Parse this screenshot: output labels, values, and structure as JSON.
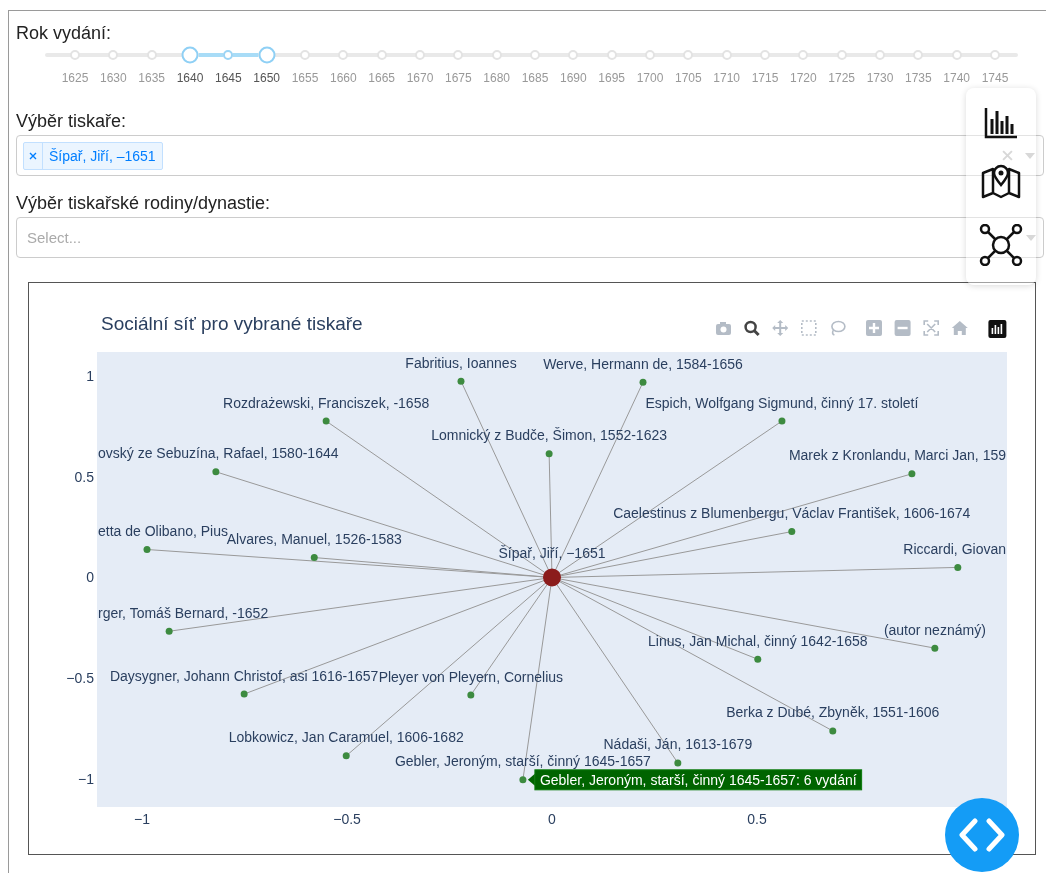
{
  "year_slider": {
    "label": "Rok vydání:",
    "marks": [
      {
        "label": "1625",
        "selected": false
      },
      {
        "label": "1630",
        "selected": false
      },
      {
        "label": "1635",
        "selected": false
      },
      {
        "label": "1640",
        "selected": true
      },
      {
        "label": "1645",
        "selected": true
      },
      {
        "label": "1650",
        "selected": true
      },
      {
        "label": "1655",
        "selected": false
      },
      {
        "label": "1660",
        "selected": false
      },
      {
        "label": "1665",
        "selected": false
      },
      {
        "label": "1670",
        "selected": false
      },
      {
        "label": "1675",
        "selected": false
      },
      {
        "label": "1680",
        "selected": false
      },
      {
        "label": "1685",
        "selected": false
      },
      {
        "label": "1690",
        "selected": false
      },
      {
        "label": "1695",
        "selected": false
      },
      {
        "label": "1700",
        "selected": false
      },
      {
        "label": "1705",
        "selected": false
      },
      {
        "label": "1710",
        "selected": false
      },
      {
        "label": "1715",
        "selected": false
      },
      {
        "label": "1720",
        "selected": false
      },
      {
        "label": "1725",
        "selected": false
      },
      {
        "label": "1730",
        "selected": false
      },
      {
        "label": "1735",
        "selected": false
      },
      {
        "label": "1740",
        "selected": false
      },
      {
        "label": "1745",
        "selected": false
      }
    ]
  },
  "printer_select": {
    "label": "Výběr tiskaře:",
    "chips": [
      {
        "text": "Šípař, Jiří, –1651"
      }
    ]
  },
  "family_select": {
    "label": "Výběr tiskařské rodiny/dynastie:",
    "placeholder": "Select..."
  },
  "graph": {
    "modebar": [
      {
        "kind": "camera",
        "selected": false
      },
      {
        "kind": "zoom",
        "selected": true
      },
      {
        "kind": "pan",
        "selected": false
      },
      {
        "kind": "select",
        "selected": false
      },
      {
        "kind": "lasso",
        "selected": false
      },
      {
        "kind": "zoom-in",
        "selected": false
      },
      {
        "kind": "zoom-out",
        "selected": false
      },
      {
        "kind": "autoscale",
        "selected": false
      },
      {
        "kind": "home",
        "selected": false
      },
      {
        "kind": "logo"
      }
    ],
    "chart_data": {
      "type": "scatter",
      "title": "Sociální síť pro vybrané tiskaře",
      "xlim": [
        -1.11,
        1.11
      ],
      "ylim": [
        -1.14,
        1.12
      ],
      "xticks": [
        {
          "value": -1,
          "label": "−1"
        },
        {
          "value": -0.5,
          "label": "−0.5"
        },
        {
          "value": 0,
          "label": "0"
        },
        {
          "value": 0.5,
          "label": "0.5"
        }
      ],
      "yticks": [
        {
          "value": 1,
          "label": "1"
        },
        {
          "value": 0.5,
          "label": "0.5"
        },
        {
          "value": 0,
          "label": "0"
        },
        {
          "value": -0.5,
          "label": "−0.5"
        },
        {
          "value": -1,
          "label": "−1"
        }
      ],
      "x": [
        0,
        -0.222,
        0.222,
        -0.551,
        0.561,
        -0.007,
        -0.82,
        0.878,
        0.585,
        -0.988,
        -0.58,
        0.99,
        -0.934,
        0.934,
        0.502,
        -0.751,
        -0.198,
        0.685,
        -0.502,
        0.307,
        -0.071
      ],
      "series": [
        {
          "name": "Šípař, Jiří, −1651",
          "color": "#8b1c1c",
          "values": [
            0,
            null,
            null,
            null,
            null,
            null,
            null,
            null,
            null,
            null,
            null,
            null,
            null,
            null,
            null,
            null,
            null,
            null,
            null,
            null,
            null
          ]
        },
        {
          "name": "Fabritius, Ioannes",
          "color": "#3d8b40",
          "values": [
            null,
            0.975,
            null,
            null,
            null,
            null,
            null,
            null,
            null,
            null,
            null,
            null,
            null,
            null,
            null,
            null,
            null,
            null,
            null,
            null,
            null
          ]
        },
        {
          "name": "Werve, Hermann de, 1584-1656",
          "color": "#3d8b40",
          "values": [
            null,
            null,
            0.97,
            null,
            null,
            null,
            null,
            null,
            null,
            null,
            null,
            null,
            null,
            null,
            null,
            null,
            null,
            null,
            null,
            null,
            null
          ]
        },
        {
          "name": "Rozdrażewski, Franciszek, -1658",
          "color": "#3d8b40",
          "values": [
            null,
            null,
            null,
            0.777,
            null,
            null,
            null,
            null,
            null,
            null,
            null,
            null,
            null,
            null,
            null,
            null,
            null,
            null,
            null,
            null,
            null
          ]
        },
        {
          "name": "Espich, Wolfgang Sigmund, činný 17. století",
          "color": "#3d8b40",
          "values": [
            null,
            null,
            null,
            null,
            0.777,
            null,
            null,
            null,
            null,
            null,
            null,
            null,
            null,
            null,
            null,
            null,
            null,
            null,
            null,
            null,
            null
          ]
        },
        {
          "name": "Lomnický z Budče, Šimon, 1552-1623",
          "color": "#3d8b40",
          "values": [
            null,
            null,
            null,
            null,
            null,
            0.614,
            null,
            null,
            null,
            null,
            null,
            null,
            null,
            null,
            null,
            null,
            null,
            null,
            null,
            null,
            null
          ]
        },
        {
          "name": "ovský ze Sebuzína, Rafael, 1580-1644",
          "color": "#3d8b40",
          "values": [
            null,
            null,
            null,
            null,
            null,
            null,
            0.525,
            null,
            null,
            null,
            null,
            null,
            null,
            null,
            null,
            null,
            null,
            null,
            null,
            null,
            null
          ]
        },
        {
          "name": "Marek z Kronlandu, Marci Jan, 159",
          "color": "#3d8b40",
          "values": [
            null,
            null,
            null,
            null,
            null,
            null,
            null,
            0.515,
            null,
            null,
            null,
            null,
            null,
            null,
            null,
            null,
            null,
            null,
            null,
            null,
            null
          ]
        },
        {
          "name": "Caelestinus z Blumenbergu, Václav František, 1606-1674",
          "color": "#3d8b40",
          "values": [
            null,
            null,
            null,
            null,
            null,
            null,
            null,
            null,
            0.228,
            null,
            null,
            null,
            null,
            null,
            null,
            null,
            null,
            null,
            null,
            null,
            null
          ]
        },
        {
          "name": "etta de Olibano, Pius",
          "color": "#3d8b40",
          "values": [
            null,
            null,
            null,
            null,
            null,
            null,
            null,
            null,
            null,
            0.139,
            null,
            null,
            null,
            null,
            null,
            null,
            null,
            null,
            null,
            null,
            null
          ]
        },
        {
          "name": "Alvares, Manuel, 1526-1583",
          "color": "#3d8b40",
          "values": [
            null,
            null,
            null,
            null,
            null,
            null,
            null,
            null,
            null,
            null,
            0.099,
            null,
            null,
            null,
            null,
            null,
            null,
            null,
            null,
            null,
            null
          ]
        },
        {
          "name": "Riccardi, Giovan",
          "color": "#3d8b40",
          "values": [
            null,
            null,
            null,
            null,
            null,
            null,
            null,
            null,
            null,
            null,
            null,
            0.05,
            null,
            null,
            null,
            null,
            null,
            null,
            null,
            null,
            null
          ]
        },
        {
          "name": "rger, Tomáš Bernard, -1652",
          "color": "#3d8b40",
          "values": [
            null,
            null,
            null,
            null,
            null,
            null,
            null,
            null,
            null,
            null,
            null,
            null,
            -0.267,
            null,
            null,
            null,
            null,
            null,
            null,
            null,
            null
          ]
        },
        {
          "name": "(autor neznámý)",
          "color": "#3d8b40",
          "values": [
            null,
            null,
            null,
            null,
            null,
            null,
            null,
            null,
            null,
            null,
            null,
            null,
            null,
            -0.351,
            null,
            null,
            null,
            null,
            null,
            null,
            null
          ]
        },
        {
          "name": "Linus, Jan Michal, činný 1642-1658",
          "color": "#3d8b40",
          "values": [
            null,
            null,
            null,
            null,
            null,
            null,
            null,
            null,
            null,
            null,
            null,
            null,
            null,
            null,
            -0.406,
            null,
            null,
            null,
            null,
            null,
            null
          ]
        },
        {
          "name": "Daysygner, Johann Christof, asi 1616-1657",
          "color": "#3d8b40",
          "values": [
            null,
            null,
            null,
            null,
            null,
            null,
            null,
            null,
            null,
            null,
            null,
            null,
            null,
            null,
            null,
            -0.579,
            null,
            null,
            null,
            null,
            null
          ]
        },
        {
          "name": "Pleyer von Pleyern, Cornelius",
          "color": "#3d8b40",
          "values": [
            null,
            null,
            null,
            null,
            null,
            null,
            null,
            null,
            null,
            null,
            null,
            null,
            null,
            null,
            null,
            null,
            -0.584,
            null,
            null,
            null,
            null
          ]
        },
        {
          "name": "Berka z Dubé, Zbyněk, 1551-1606",
          "color": "#3d8b40",
          "values": [
            null,
            null,
            null,
            null,
            null,
            null,
            null,
            null,
            null,
            null,
            null,
            null,
            null,
            null,
            null,
            null,
            null,
            -0.762,
            null,
            null,
            null
          ]
        },
        {
          "name": "Lobkowicz, Jan Caramuel, 1606-1682",
          "color": "#3d8b40",
          "values": [
            null,
            null,
            null,
            null,
            null,
            null,
            null,
            null,
            null,
            null,
            null,
            null,
            null,
            null,
            null,
            null,
            null,
            null,
            -0.886,
            null,
            null
          ]
        },
        {
          "name": "Nádaši, Ján, 1613-1679",
          "color": "#3d8b40",
          "values": [
            null,
            null,
            null,
            null,
            null,
            null,
            null,
            null,
            null,
            null,
            null,
            null,
            null,
            null,
            null,
            null,
            null,
            null,
            null,
            -0.921,
            null
          ]
        },
        {
          "name": "Gebler, Jeroným, starší, činný 1645-1657",
          "color": "#3d8b40",
          "values": [
            null,
            null,
            null,
            null,
            null,
            null,
            null,
            null,
            null,
            null,
            null,
            null,
            null,
            null,
            null,
            null,
            null,
            null,
            null,
            null,
            -1.005
          ]
        }
      ],
      "annotations": [
        {
          "text": "Gebler, Jeroným, starší, činný 1645-1657: 6 vydání",
          "x": -0.071,
          "y": -1.005
        }
      ]
    }
  }
}
